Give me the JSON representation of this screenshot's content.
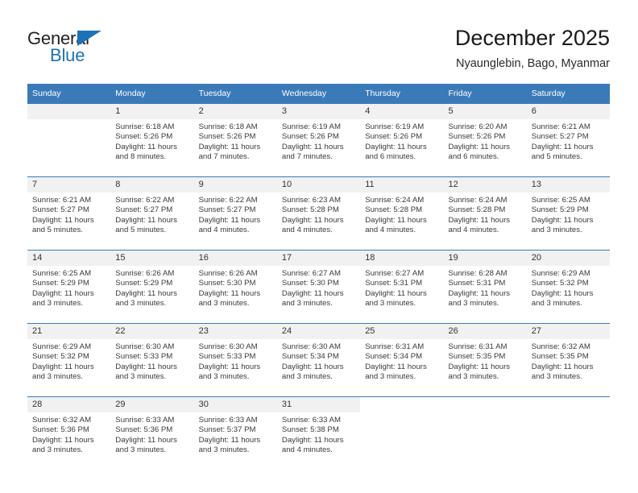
{
  "brand": {
    "primary_text": "General",
    "secondary_text": "Blue",
    "primary_color": "#231f20",
    "secondary_color": "#1d72b8",
    "triangle_color": "#1d72b8"
  },
  "header": {
    "title": "December 2025",
    "subtitle": "Nyaunglebin, Bago, Myanmar"
  },
  "theme": {
    "header_bg": "#3b7ab9",
    "header_text": "#ffffff",
    "daynum_bg": "#f1f1f1",
    "row_divider": "#3b7ab9"
  },
  "calendar": {
    "weekday_headers": [
      "Sunday",
      "Monday",
      "Tuesday",
      "Wednesday",
      "Thursday",
      "Friday",
      "Saturday"
    ],
    "weeks": [
      [
        {
          "day": "",
          "sunrise": "",
          "sunset": "",
          "daylight_line1": "",
          "daylight_line2": "",
          "blank": true
        },
        {
          "day": "1",
          "sunrise": "Sunrise: 6:18 AM",
          "sunset": "Sunset: 5:26 PM",
          "daylight_line1": "Daylight: 11 hours",
          "daylight_line2": "and 8 minutes."
        },
        {
          "day": "2",
          "sunrise": "Sunrise: 6:18 AM",
          "sunset": "Sunset: 5:26 PM",
          "daylight_line1": "Daylight: 11 hours",
          "daylight_line2": "and 7 minutes."
        },
        {
          "day": "3",
          "sunrise": "Sunrise: 6:19 AM",
          "sunset": "Sunset: 5:26 PM",
          "daylight_line1": "Daylight: 11 hours",
          "daylight_line2": "and 7 minutes."
        },
        {
          "day": "4",
          "sunrise": "Sunrise: 6:19 AM",
          "sunset": "Sunset: 5:26 PM",
          "daylight_line1": "Daylight: 11 hours",
          "daylight_line2": "and 6 minutes."
        },
        {
          "day": "5",
          "sunrise": "Sunrise: 6:20 AM",
          "sunset": "Sunset: 5:26 PM",
          "daylight_line1": "Daylight: 11 hours",
          "daylight_line2": "and 6 minutes."
        },
        {
          "day": "6",
          "sunrise": "Sunrise: 6:21 AM",
          "sunset": "Sunset: 5:27 PM",
          "daylight_line1": "Daylight: 11 hours",
          "daylight_line2": "and 5 minutes."
        }
      ],
      [
        {
          "day": "7",
          "sunrise": "Sunrise: 6:21 AM",
          "sunset": "Sunset: 5:27 PM",
          "daylight_line1": "Daylight: 11 hours",
          "daylight_line2": "and 5 minutes."
        },
        {
          "day": "8",
          "sunrise": "Sunrise: 6:22 AM",
          "sunset": "Sunset: 5:27 PM",
          "daylight_line1": "Daylight: 11 hours",
          "daylight_line2": "and 5 minutes."
        },
        {
          "day": "9",
          "sunrise": "Sunrise: 6:22 AM",
          "sunset": "Sunset: 5:27 PM",
          "daylight_line1": "Daylight: 11 hours",
          "daylight_line2": "and 4 minutes."
        },
        {
          "day": "10",
          "sunrise": "Sunrise: 6:23 AM",
          "sunset": "Sunset: 5:28 PM",
          "daylight_line1": "Daylight: 11 hours",
          "daylight_line2": "and 4 minutes."
        },
        {
          "day": "11",
          "sunrise": "Sunrise: 6:24 AM",
          "sunset": "Sunset: 5:28 PM",
          "daylight_line1": "Daylight: 11 hours",
          "daylight_line2": "and 4 minutes."
        },
        {
          "day": "12",
          "sunrise": "Sunrise: 6:24 AM",
          "sunset": "Sunset: 5:28 PM",
          "daylight_line1": "Daylight: 11 hours",
          "daylight_line2": "and 4 minutes."
        },
        {
          "day": "13",
          "sunrise": "Sunrise: 6:25 AM",
          "sunset": "Sunset: 5:29 PM",
          "daylight_line1": "Daylight: 11 hours",
          "daylight_line2": "and 3 minutes."
        }
      ],
      [
        {
          "day": "14",
          "sunrise": "Sunrise: 6:25 AM",
          "sunset": "Sunset: 5:29 PM",
          "daylight_line1": "Daylight: 11 hours",
          "daylight_line2": "and 3 minutes."
        },
        {
          "day": "15",
          "sunrise": "Sunrise: 6:26 AM",
          "sunset": "Sunset: 5:29 PM",
          "daylight_line1": "Daylight: 11 hours",
          "daylight_line2": "and 3 minutes."
        },
        {
          "day": "16",
          "sunrise": "Sunrise: 6:26 AM",
          "sunset": "Sunset: 5:30 PM",
          "daylight_line1": "Daylight: 11 hours",
          "daylight_line2": "and 3 minutes."
        },
        {
          "day": "17",
          "sunrise": "Sunrise: 6:27 AM",
          "sunset": "Sunset: 5:30 PM",
          "daylight_line1": "Daylight: 11 hours",
          "daylight_line2": "and 3 minutes."
        },
        {
          "day": "18",
          "sunrise": "Sunrise: 6:27 AM",
          "sunset": "Sunset: 5:31 PM",
          "daylight_line1": "Daylight: 11 hours",
          "daylight_line2": "and 3 minutes."
        },
        {
          "day": "19",
          "sunrise": "Sunrise: 6:28 AM",
          "sunset": "Sunset: 5:31 PM",
          "daylight_line1": "Daylight: 11 hours",
          "daylight_line2": "and 3 minutes."
        },
        {
          "day": "20",
          "sunrise": "Sunrise: 6:29 AM",
          "sunset": "Sunset: 5:32 PM",
          "daylight_line1": "Daylight: 11 hours",
          "daylight_line2": "and 3 minutes."
        }
      ],
      [
        {
          "day": "21",
          "sunrise": "Sunrise: 6:29 AM",
          "sunset": "Sunset: 5:32 PM",
          "daylight_line1": "Daylight: 11 hours",
          "daylight_line2": "and 3 minutes."
        },
        {
          "day": "22",
          "sunrise": "Sunrise: 6:30 AM",
          "sunset": "Sunset: 5:33 PM",
          "daylight_line1": "Daylight: 11 hours",
          "daylight_line2": "and 3 minutes."
        },
        {
          "day": "23",
          "sunrise": "Sunrise: 6:30 AM",
          "sunset": "Sunset: 5:33 PM",
          "daylight_line1": "Daylight: 11 hours",
          "daylight_line2": "and 3 minutes."
        },
        {
          "day": "24",
          "sunrise": "Sunrise: 6:30 AM",
          "sunset": "Sunset: 5:34 PM",
          "daylight_line1": "Daylight: 11 hours",
          "daylight_line2": "and 3 minutes."
        },
        {
          "day": "25",
          "sunrise": "Sunrise: 6:31 AM",
          "sunset": "Sunset: 5:34 PM",
          "daylight_line1": "Daylight: 11 hours",
          "daylight_line2": "and 3 minutes."
        },
        {
          "day": "26",
          "sunrise": "Sunrise: 6:31 AM",
          "sunset": "Sunset: 5:35 PM",
          "daylight_line1": "Daylight: 11 hours",
          "daylight_line2": "and 3 minutes."
        },
        {
          "day": "27",
          "sunrise": "Sunrise: 6:32 AM",
          "sunset": "Sunset: 5:35 PM",
          "daylight_line1": "Daylight: 11 hours",
          "daylight_line2": "and 3 minutes."
        }
      ],
      [
        {
          "day": "28",
          "sunrise": "Sunrise: 6:32 AM",
          "sunset": "Sunset: 5:36 PM",
          "daylight_line1": "Daylight: 11 hours",
          "daylight_line2": "and 3 minutes."
        },
        {
          "day": "29",
          "sunrise": "Sunrise: 6:33 AM",
          "sunset": "Sunset: 5:36 PM",
          "daylight_line1": "Daylight: 11 hours",
          "daylight_line2": "and 3 minutes."
        },
        {
          "day": "30",
          "sunrise": "Sunrise: 6:33 AM",
          "sunset": "Sunset: 5:37 PM",
          "daylight_line1": "Daylight: 11 hours",
          "daylight_line2": "and 3 minutes."
        },
        {
          "day": "31",
          "sunrise": "Sunrise: 6:33 AM",
          "sunset": "Sunset: 5:38 PM",
          "daylight_line1": "Daylight: 11 hours",
          "daylight_line2": "and 4 minutes."
        },
        {
          "day": "",
          "sunrise": "",
          "sunset": "",
          "daylight_line1": "",
          "daylight_line2": "",
          "empty": true
        },
        {
          "day": "",
          "sunrise": "",
          "sunset": "",
          "daylight_line1": "",
          "daylight_line2": "",
          "empty": true
        },
        {
          "day": "",
          "sunrise": "",
          "sunset": "",
          "daylight_line1": "",
          "daylight_line2": "",
          "empty": true
        }
      ]
    ]
  }
}
